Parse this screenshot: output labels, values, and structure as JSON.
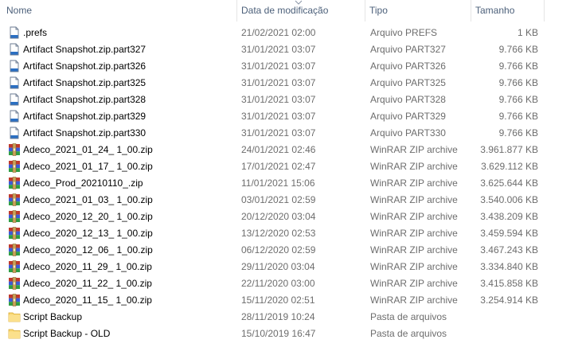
{
  "columns": {
    "name": "Nome",
    "date": "Data de modificação",
    "type": "Tipo",
    "size": "Tamanho"
  },
  "rows": [
    {
      "icon": "file-icon",
      "name": ".prefs",
      "date": "21/02/2021 02:00",
      "type": "Arquivo PREFS",
      "size": "1 KB"
    },
    {
      "icon": "file-icon",
      "name": "Artifact Snapshot.zip.part327",
      "date": "31/01/2021 03:07",
      "type": "Arquivo PART327",
      "size": "9.766 KB"
    },
    {
      "icon": "file-icon",
      "name": "Artifact Snapshot.zip.part326",
      "date": "31/01/2021 03:07",
      "type": "Arquivo PART326",
      "size": "9.766 KB"
    },
    {
      "icon": "file-icon",
      "name": "Artifact Snapshot.zip.part325",
      "date": "31/01/2021 03:07",
      "type": "Arquivo PART325",
      "size": "9.766 KB"
    },
    {
      "icon": "file-icon",
      "name": "Artifact Snapshot.zip.part328",
      "date": "31/01/2021 03:07",
      "type": "Arquivo PART328",
      "size": "9.766 KB"
    },
    {
      "icon": "file-icon",
      "name": "Artifact Snapshot.zip.part329",
      "date": "31/01/2021 03:07",
      "type": "Arquivo PART329",
      "size": "9.766 KB"
    },
    {
      "icon": "file-icon",
      "name": "Artifact Snapshot.zip.part330",
      "date": "31/01/2021 03:07",
      "type": "Arquivo PART330",
      "size": "9.766 KB"
    },
    {
      "icon": "winrar-icon",
      "name": "Adeco_2021_01_24_ 1_00.zip",
      "date": "24/01/2021 02:46",
      "type": "WinRAR ZIP archive",
      "size": "3.961.877 KB"
    },
    {
      "icon": "winrar-icon",
      "name": "Adeco_2021_01_17_ 1_00.zip",
      "date": "17/01/2021 02:47",
      "type": "WinRAR ZIP archive",
      "size": "3.629.112 KB"
    },
    {
      "icon": "winrar-icon",
      "name": "Adeco_Prod_20210110_.zip",
      "date": "11/01/2021 15:06",
      "type": "WinRAR ZIP archive",
      "size": "3.625.644 KB"
    },
    {
      "icon": "winrar-icon",
      "name": "Adeco_2021_01_03_ 1_00.zip",
      "date": "03/01/2021 02:59",
      "type": "WinRAR ZIP archive",
      "size": "3.540.006 KB"
    },
    {
      "icon": "winrar-icon",
      "name": "Adeco_2020_12_20_ 1_00.zip",
      "date": "20/12/2020 03:04",
      "type": "WinRAR ZIP archive",
      "size": "3.438.209 KB"
    },
    {
      "icon": "winrar-icon",
      "name": "Adeco_2020_12_13_ 1_00.zip",
      "date": "13/12/2020 02:53",
      "type": "WinRAR ZIP archive",
      "size": "3.459.594 KB"
    },
    {
      "icon": "winrar-icon",
      "name": "Adeco_2020_12_06_ 1_00.zip",
      "date": "06/12/2020 02:59",
      "type": "WinRAR ZIP archive",
      "size": "3.467.243 KB"
    },
    {
      "icon": "winrar-icon",
      "name": "Adeco_2020_11_29_ 1_00.zip",
      "date": "29/11/2020 03:04",
      "type": "WinRAR ZIP archive",
      "size": "3.334.840 KB"
    },
    {
      "icon": "winrar-icon",
      "name": "Adeco_2020_11_22_ 1_00.zip",
      "date": "22/11/2020 03:00",
      "type": "WinRAR ZIP archive",
      "size": "3.415.858 KB"
    },
    {
      "icon": "winrar-icon",
      "name": "Adeco_2020_11_15_ 1_00.zip",
      "date": "15/11/2020 02:51",
      "type": "WinRAR ZIP archive",
      "size": "3.254.914 KB"
    },
    {
      "icon": "folder-icon",
      "name": "Script Backup",
      "date": "28/11/2019 10:24",
      "type": "Pasta de arquivos",
      "size": ""
    },
    {
      "icon": "folder-icon",
      "name": "Script Backup - OLD",
      "date": "15/10/2019 16:47",
      "type": "Pasta de arquivos",
      "size": ""
    }
  ],
  "colors": {
    "header_text": "#4c607a",
    "detail_text": "#6d6d6d",
    "folder": "#f8d775",
    "winrar_red": "#c0392b",
    "winrar_blue": "#3b5bdb",
    "winrar_green": "#2f9e44"
  }
}
